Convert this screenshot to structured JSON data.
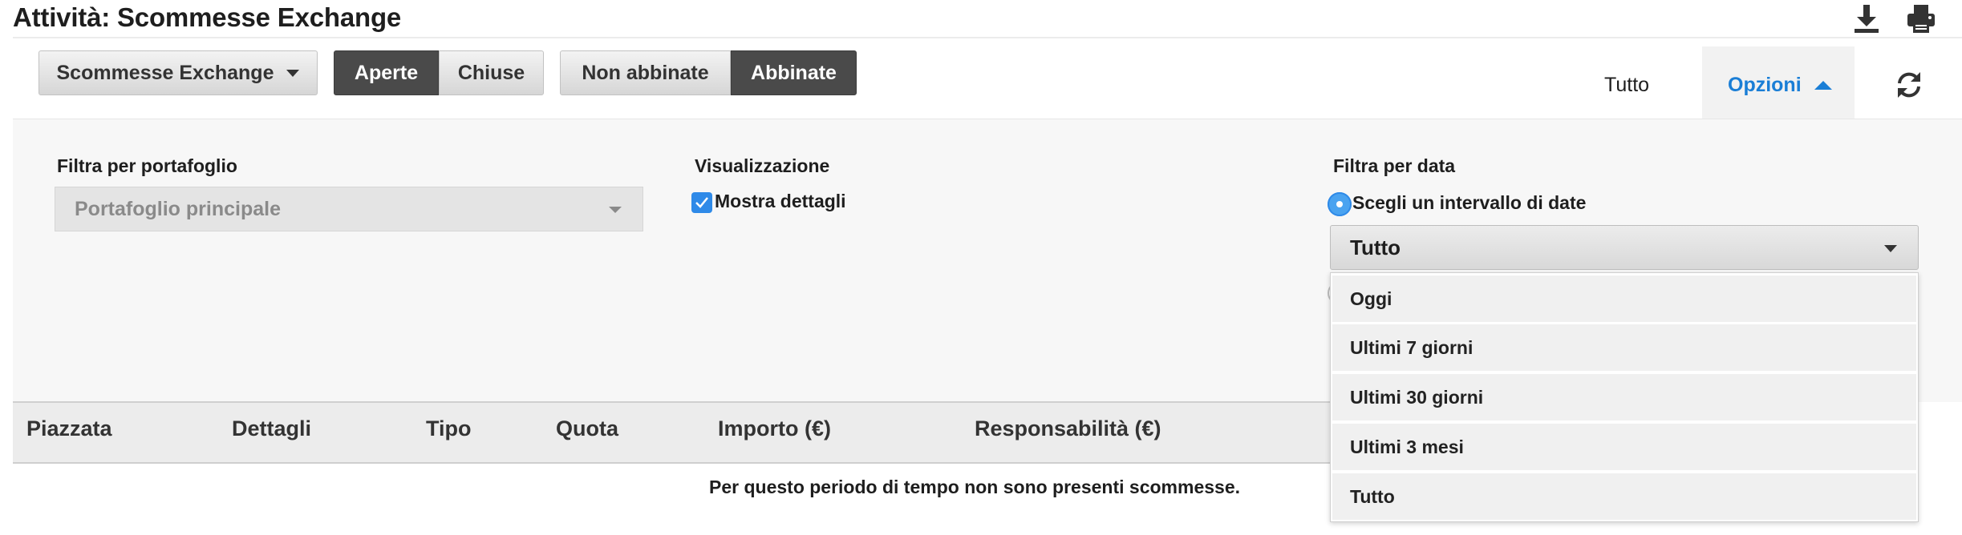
{
  "page": {
    "title": "Attività: Scommesse Exchange",
    "download_icon": "download-icon",
    "print_icon": "print-icon"
  },
  "toolbar": {
    "market_dropdown_label": "Scommesse Exchange",
    "status_toggle": [
      {
        "label": "Aperte",
        "active": true
      },
      {
        "label": "Chiuse",
        "active": false
      }
    ],
    "match_toggle": [
      {
        "label": "Non abbinate",
        "active": false
      },
      {
        "label": "Abbinate",
        "active": true
      }
    ]
  },
  "tabs": {
    "all_label": "Tutto",
    "options_label": "Opzioni",
    "options_expanded": true,
    "refresh_icon": "refresh-icon",
    "accent_color": "#1a7ed6"
  },
  "options": {
    "portfolio": {
      "label": "Filtra per portafoglio",
      "selected": "Portafoglio principale",
      "disabled": true
    },
    "display": {
      "label": "Visualizzazione",
      "show_details_label": "Mostra dettagli",
      "show_details_checked": true
    },
    "date_filter": {
      "label": "Filtra per data",
      "range_option_label": "Scegli un intervallo di date",
      "range_selected": true,
      "selected": "Tutto",
      "dropdown_open": true,
      "options": [
        "Oggi",
        "Ultimi 7 giorni",
        "Ultimi 30 giorni",
        "Ultimi 3 mesi",
        "Tutto"
      ]
    }
  },
  "table": {
    "columns": [
      "Piazzata",
      "Dettagli",
      "Tipo",
      "Quota",
      "Importo (€)",
      "Responsabilità (€)"
    ],
    "empty_message": "Per questo periodo di tempo non sono presenti scommesse."
  }
}
